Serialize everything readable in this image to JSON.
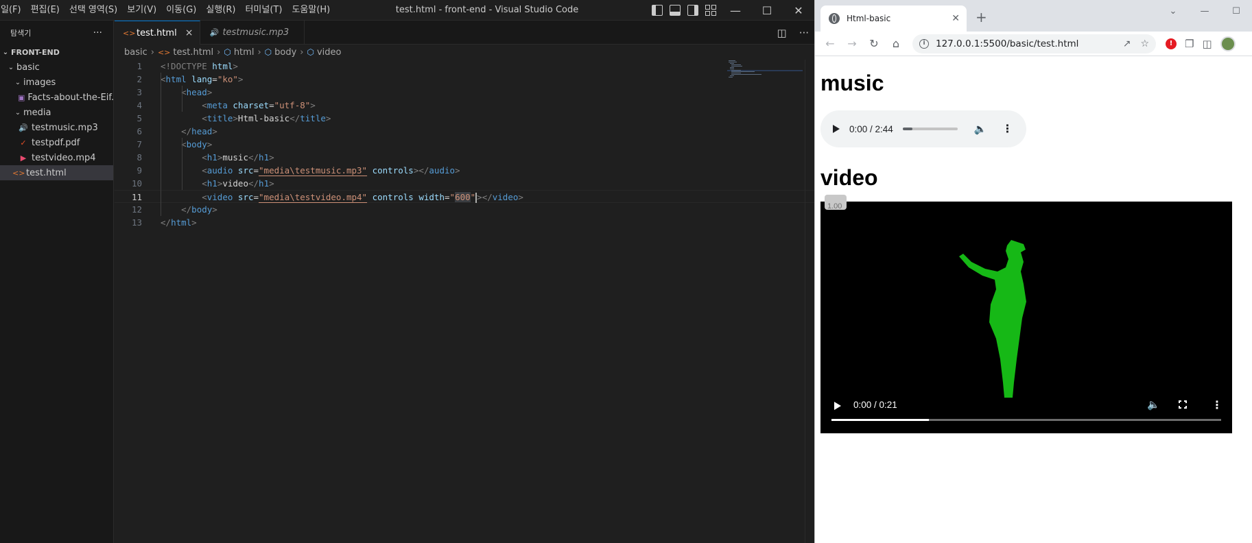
{
  "vscode": {
    "menu": [
      "일(F)",
      "편집(E)",
      "선택 영역(S)",
      "보기(V)",
      "이동(G)",
      "실행(R)",
      "터미널(T)",
      "도움말(H)"
    ],
    "window_title": "test.html - front-end - Visual Studio Code",
    "explorer_title": "탐색기",
    "explorer_more": "···",
    "tree": {
      "root": "FRONT-END",
      "basic": "basic",
      "images": "images",
      "image_file": "Facts-about-the-Eif...",
      "media": "media",
      "mp3": "testmusic.mp3",
      "pdf": "testpdf.pdf",
      "mp4": "testvideo.mp4",
      "html": "test.html"
    },
    "tabs": [
      {
        "label": "test.html",
        "close": "×"
      },
      {
        "label": "testmusic.mp3"
      }
    ],
    "breadcrumb": [
      "basic",
      "test.html",
      "html",
      "body",
      "video"
    ],
    "line_numbers": [
      "1",
      "2",
      "3",
      "4",
      "5",
      "6",
      "7",
      "8",
      "9",
      "10",
      "11",
      "12",
      "13"
    ],
    "code": {
      "l1": {
        "a": "<!DOCTYPE ",
        "b": "html",
        "c": ">"
      },
      "l2": {
        "tag": "html",
        "attr": "lang",
        "val": "\"ko\""
      },
      "l3": "head",
      "l4": {
        "tag": "meta",
        "attr": "charset",
        "val": "\"utf-8\""
      },
      "l5": {
        "tag": "title",
        "text": "Html-basic"
      },
      "l6": "head",
      "l7": "body",
      "l8": {
        "tag": "h1",
        "text": "music"
      },
      "l9": {
        "tag": "audio",
        "attr": "src",
        "val": "\"media\\testmusic.mp3\"",
        "attr2": "controls"
      },
      "l10": {
        "tag": "h1",
        "text": "video"
      },
      "l11": {
        "tag": "video",
        "attr": "src",
        "val": "\"media\\testvideo.mp4\"",
        "attr2": "controls",
        "attr3": "width",
        "val3a": "\"",
        "val3b": "600",
        "val3c": "\""
      },
      "l12": "body",
      "l13": "html"
    }
  },
  "chrome": {
    "tab_title": "Html-basic",
    "url": "127.0.0.1:5500/basic/test.html",
    "page": {
      "h1_music": "music",
      "audio_time": "0:00 / 2:44",
      "audio_progress": 0.18,
      "h1_video": "video",
      "video_speed": "1.00",
      "video_time": "0:00 / 0:21",
      "video_progress": 0.25
    }
  }
}
